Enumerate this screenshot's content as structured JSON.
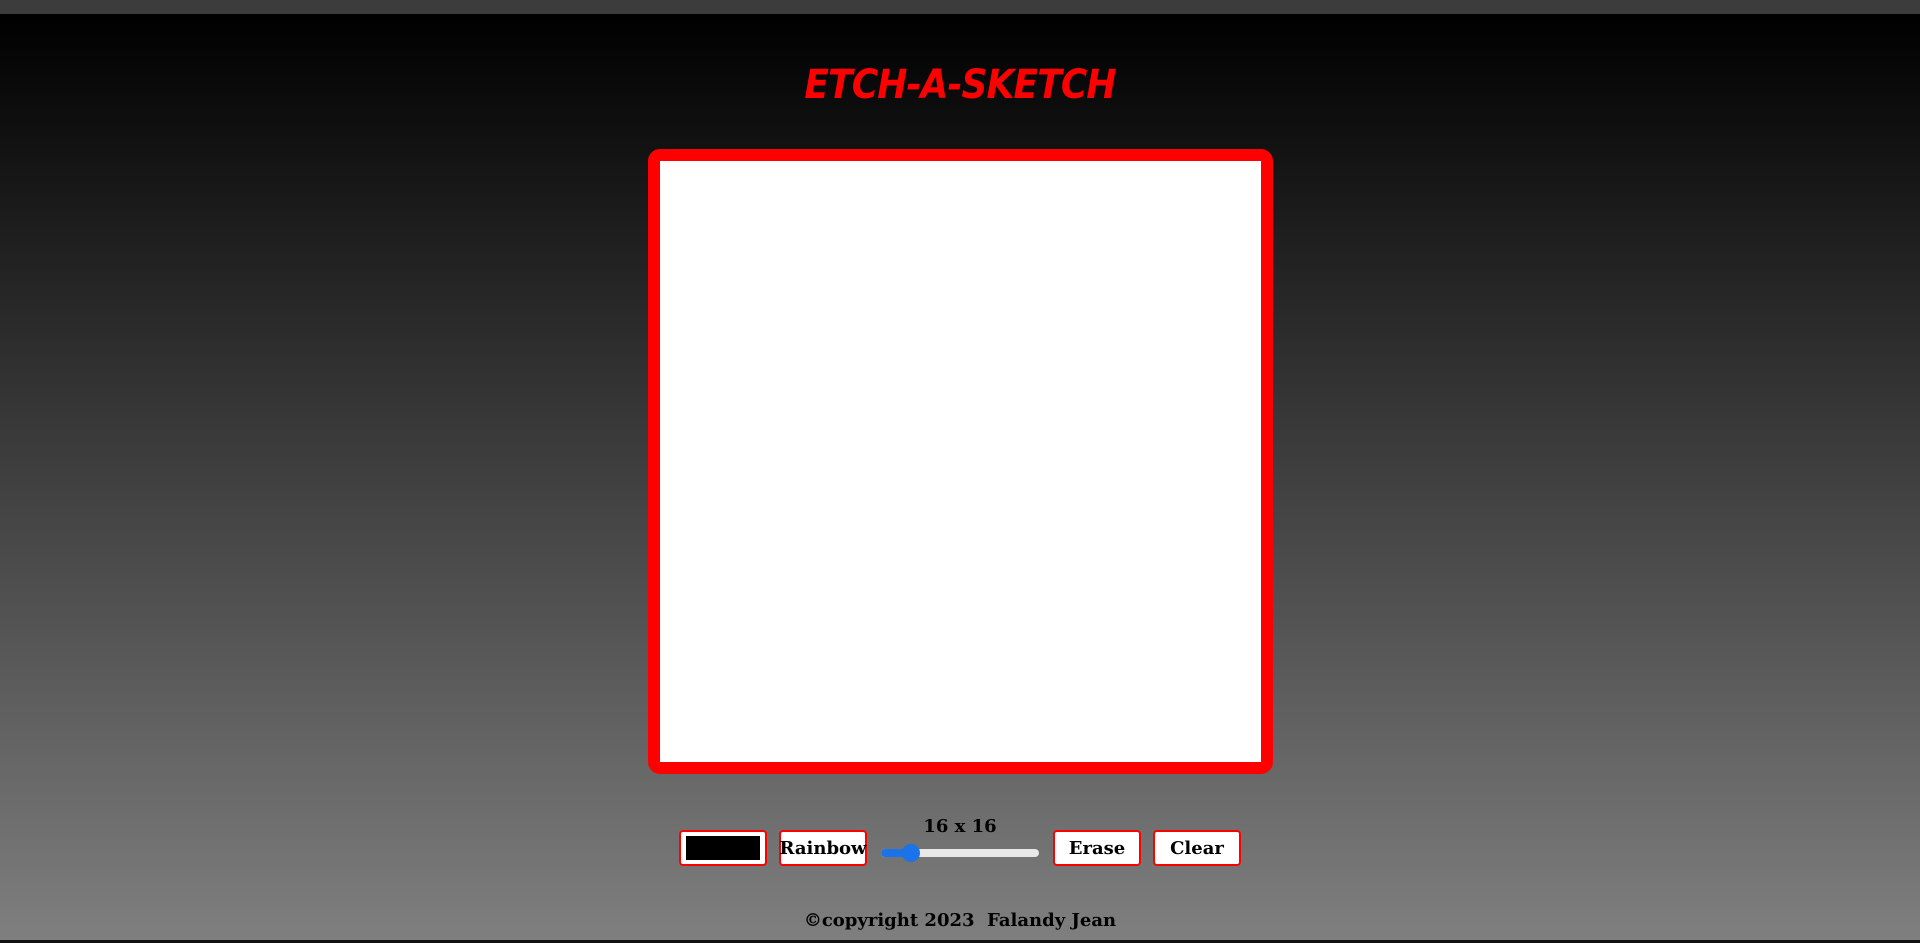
{
  "app": {
    "title": "ETCH-A-SKETCH"
  },
  "canvas": {
    "border_color": "#ff0000",
    "background_color": "#ffffff"
  },
  "controls": {
    "color_value": "#000000",
    "rainbow_label": "Rainbow",
    "grid_size_label": "16 x 16",
    "grid_size_min": 1,
    "grid_size_max": 100,
    "grid_size_value": 16,
    "erase_label": "Erase",
    "clear_label": "Clear"
  },
  "footer": {
    "text": "©copyright 2023  Falandy Jean"
  },
  "colors": {
    "accent": "#ff0000",
    "slider": "#1a73e8"
  }
}
